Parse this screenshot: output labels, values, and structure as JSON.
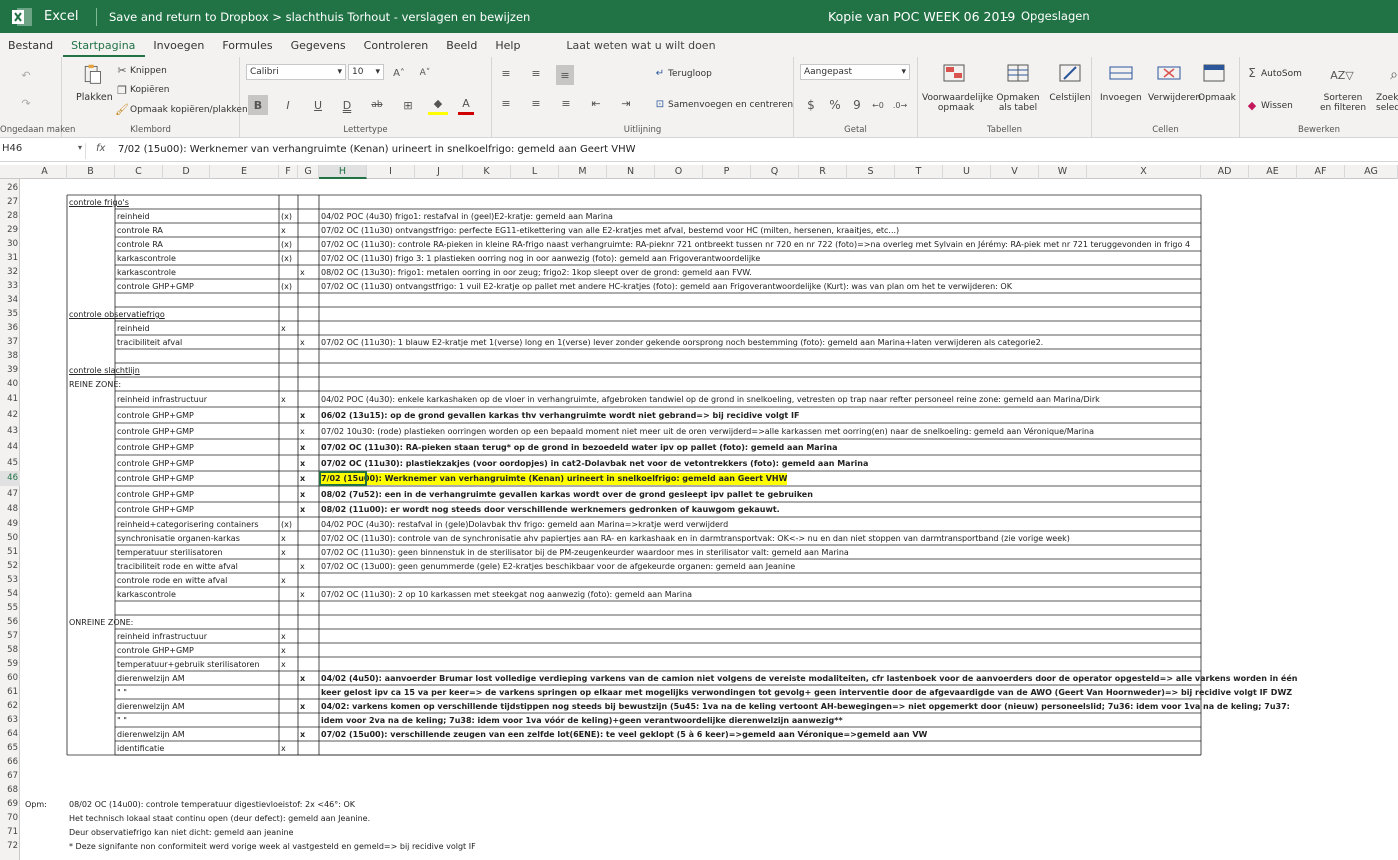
{
  "titlebar": {
    "app": "Excel",
    "breadcrumb": "Save and return to Dropbox  >  slachthuis Torhout - verslagen en bewijzen",
    "doc_title": "Kopie van POC WEEK 06 2019",
    "dash": "-",
    "status": "Opgeslagen"
  },
  "tabs": [
    "Bestand",
    "Startpagina",
    "Invoegen",
    "Formules",
    "Gegevens",
    "Controleren",
    "Beeld",
    "Help"
  ],
  "tell_me": "Laat weten wat u wilt doen",
  "ribbon": {
    "undo_group": "Ongedaan maken",
    "clipboard": {
      "paste": "Plakken",
      "cut": "Knippen",
      "copy": "Kopiëren",
      "format_painter": "Opmaak kopiëren/plakken",
      "label": "Klembord"
    },
    "font": {
      "name": "Calibri",
      "size": "10",
      "bold": "B",
      "italic": "I",
      "underline": "U",
      "double_underline": "D",
      "strike": "ab",
      "label": "Lettertype"
    },
    "alignment": {
      "wrap": "Terugloop",
      "merge": "Samenvoegen en centreren",
      "label": "Uitlijning"
    },
    "number": {
      "format": "Aangepast",
      "currency": "$",
      "percent": "%",
      "comma": "9",
      "label": "Getal"
    },
    "tables": {
      "conditional": "Voorwaardelijke opmaak",
      "format_table": "Opmaken als tabel",
      "cell_styles": "Celstijlen",
      "label": "Tabellen"
    },
    "cells": {
      "insert": "Invoegen",
      "delete": "Verwijderen",
      "format": "Opmaak",
      "label": "Cellen"
    },
    "editing": {
      "autosum": "AutoSom",
      "clear": "Wissen",
      "sort": "Sorteren en filteren",
      "find": "Zoeken en selecteren",
      "label": "Bewerken"
    }
  },
  "formula_bar": {
    "name_box": "H46",
    "fx": "fx",
    "value": "7/02 (15u00): Werknemer van verhangruimte (Kenan) urineert in snelkoelfrigo: gemeld aan Geert VHW"
  },
  "columns": [
    "A",
    "B",
    "C",
    "D",
    "E",
    "F",
    "G",
    "H",
    "I",
    "J",
    "K",
    "L",
    "M",
    "N",
    "O",
    "P",
    "Q",
    "R",
    "S",
    "T",
    "U",
    "V",
    "W",
    "X",
    "AD",
    "AE",
    "AF",
    "AG"
  ],
  "selected_column": "H",
  "selected_row": "46",
  "row_numbers": [
    "26",
    "27",
    "28",
    "29",
    "30",
    "31",
    "32",
    "33",
    "34",
    "35",
    "36",
    "37",
    "38",
    "39",
    "40",
    "41",
    "42",
    "43",
    "44",
    "45",
    "46",
    "47",
    "48",
    "49",
    "50",
    "51",
    "52",
    "53",
    "54",
    "55",
    "56",
    "57",
    "58",
    "59",
    "60",
    "61",
    "62",
    "63",
    "64",
    "65",
    "66",
    "67",
    "68",
    "69",
    "70",
    "71",
    "72"
  ],
  "cells": [
    {
      "row": "27",
      "col": "B",
      "text": "controle frigo's",
      "style": "u"
    },
    {
      "row": "28",
      "col": "C",
      "text": "reinheid"
    },
    {
      "row": "28",
      "col": "F",
      "text": "(x)"
    },
    {
      "row": "28",
      "col": "H",
      "text": "04/02 POC (4u30) frigo1: restafval in (geel)E2-kratje: gemeld aan Marina"
    },
    {
      "row": "29",
      "col": "C",
      "text": "controle RA"
    },
    {
      "row": "29",
      "col": "F",
      "text": "x"
    },
    {
      "row": "29",
      "col": "H",
      "text": "07/02 OC (11u30) ontvangstfrigo: perfecte EG11-etikettering van alle E2-kratjes met afval, bestemd voor HC (milten, hersenen, kraaitjes, etc...)"
    },
    {
      "row": "30",
      "col": "C",
      "text": "controle RA"
    },
    {
      "row": "30",
      "col": "F",
      "text": "(x)"
    },
    {
      "row": "30",
      "col": "H",
      "text": "07/02 OC (11u30): controle RA-pieken in kleine RA-frigo naast verhangruimte: RA-pieknr 721 ontbreekt tussen nr 720 en nr 722 (foto)=>na overleg met Sylvain en Jérémy: RA-piek met nr 721 teruggevonden in frigo 4"
    },
    {
      "row": "31",
      "col": "C",
      "text": "karkascontrole"
    },
    {
      "row": "31",
      "col": "F",
      "text": "(x)"
    },
    {
      "row": "31",
      "col": "H",
      "text": "07/02 OC (11u30) frigo 3: 1 plastieken oorring nog in oor aanwezig (foto): gemeld aan Frigoverantwoordelijke"
    },
    {
      "row": "32",
      "col": "C",
      "text": "karkascontrole"
    },
    {
      "row": "32",
      "col": "G",
      "text": "x"
    },
    {
      "row": "32",
      "col": "H",
      "text": "08/02 OC (13u30): frigo1: metalen oorring in oor zeug; frigo2: 1kop sleept over de grond: gemeld aan FVW."
    },
    {
      "row": "33",
      "col": "C",
      "text": "controle GHP+GMP"
    },
    {
      "row": "33",
      "col": "F",
      "text": "(x)"
    },
    {
      "row": "33",
      "col": "H",
      "text": "07/02 OC (11u30) ontvangstfrigo: 1 vuil E2-kratje op pallet met andere HC-kratjes (foto): gemeld aan Frigoverantwoordelijke (Kurt): was van plan om het te verwijderen: OK"
    },
    {
      "row": "35",
      "col": "B",
      "text": "controle observatiefrigo",
      "style": "u"
    },
    {
      "row": "36",
      "col": "C",
      "text": "reinheid"
    },
    {
      "row": "36",
      "col": "F",
      "text": "x"
    },
    {
      "row": "37",
      "col": "C",
      "text": "tracibiliteit afval"
    },
    {
      "row": "37",
      "col": "G",
      "text": "x"
    },
    {
      "row": "37",
      "col": "H",
      "text": "07/02 OC (11u30): 1 blauw E2-kratje met 1(verse) long en 1(verse) lever zonder gekende oorsprong noch bestemming (foto): gemeld aan Marina+laten verwijderen als categorie2."
    },
    {
      "row": "39",
      "col": "B",
      "text": "controle slachtlijn",
      "style": "u"
    },
    {
      "row": "40",
      "col": "B",
      "text": "  REINE ZONE:"
    },
    {
      "row": "41",
      "col": "C",
      "text": "reinheid infrastructuur"
    },
    {
      "row": "41",
      "col": "F",
      "text": "x"
    },
    {
      "row": "41",
      "col": "H",
      "text": "04/02 POC (4u30): enkele karkashaken op de vloer in verhangruimte, afgebroken tandwiel op de grond in snelkoeling, vetresten op trap naar refter personeel reine zone: gemeld aan Marina/Dirk"
    },
    {
      "row": "42",
      "col": "C",
      "text": "controle GHP+GMP"
    },
    {
      "row": "42",
      "col": "G",
      "text": "x",
      "style": "b"
    },
    {
      "row": "42",
      "col": "H",
      "text": "06/02 (13u15): op de grond gevallen karkas thv verhangruimte wordt niet gebrand=> bij recidive volgt IF",
      "style": "b"
    },
    {
      "row": "43",
      "col": "C",
      "text": "controle GHP+GMP"
    },
    {
      "row": "43",
      "col": "G",
      "text": "x"
    },
    {
      "row": "43",
      "col": "H",
      "text": "07/02 10u30: (rode) plastieken oorringen worden op een bepaald moment niet meer uit de oren verwijderd=>alle karkassen met oorring(en) naar de snelkoeling: gemeld aan Véronique/Marina"
    },
    {
      "row": "44",
      "col": "C",
      "text": "controle GHP+GMP"
    },
    {
      "row": "44",
      "col": "G",
      "text": "x",
      "style": "b"
    },
    {
      "row": "44",
      "col": "H",
      "text": "07/02 OC (11u30): RA-pieken staan terug* op de grond in bezoedeld water ipv op pallet (foto): gemeld aan Marina",
      "style": "b"
    },
    {
      "row": "45",
      "col": "C",
      "text": "controle GHP+GMP"
    },
    {
      "row": "45",
      "col": "G",
      "text": "x",
      "style": "b"
    },
    {
      "row": "45",
      "col": "H",
      "text": "07/02 OC (11u30): plastiekzakjes (voor oordopjes) in cat2-Dolavbak net voor de vetontrekkers (foto): gemeld aan Marina",
      "style": "b"
    },
    {
      "row": "46",
      "col": "C",
      "text": "controle GHP+GMP"
    },
    {
      "row": "46",
      "col": "G",
      "text": "x",
      "style": "b"
    },
    {
      "row": "46",
      "col": "H",
      "text": "7/02 (15u00): Werknemer van verhangruimte (Kenan) urineert in snelkoelfrigo: gemeld aan Geert VHW",
      "style": "b hl"
    },
    {
      "row": "47",
      "col": "C",
      "text": "controle GHP+GMP"
    },
    {
      "row": "47",
      "col": "G",
      "text": "x",
      "style": "b"
    },
    {
      "row": "47",
      "col": "H",
      "text": "08/02 (7u52): een in de verhangruimte gevallen karkas wordt over de grond gesleept ipv pallet te gebruiken",
      "style": "b"
    },
    {
      "row": "48",
      "col": "C",
      "text": "controle GHP+GMP"
    },
    {
      "row": "48",
      "col": "G",
      "text": "x",
      "style": "b"
    },
    {
      "row": "48",
      "col": "H",
      "text": "08/02 (11u00): er wordt nog steeds door verschillende werknemers gedronken of kauwgom gekauwt.",
      "style": "b"
    },
    {
      "row": "49",
      "col": "C",
      "text": "reinheid+categorisering containers"
    },
    {
      "row": "49",
      "col": "F",
      "text": "(x)"
    },
    {
      "row": "49",
      "col": "H",
      "text": "04/02 POC (4u30): restafval in (gele)Dolavbak thv frigo: gemeld aan Marina=>kratje werd verwijderd"
    },
    {
      "row": "50",
      "col": "C",
      "text": "synchronisatie organen-karkas"
    },
    {
      "row": "50",
      "col": "F",
      "text": "x"
    },
    {
      "row": "50",
      "col": "H",
      "text": "07/02 OC (11u30):  controle van de synchronisatie ahv papiertjes aan RA- en karkashaak en in darmtransportvak: OK<-> nu en dan niet stoppen van darmtransportband (zie vorige week)"
    },
    {
      "row": "51",
      "col": "C",
      "text": "temperatuur sterilisatoren"
    },
    {
      "row": "51",
      "col": "F",
      "text": "x"
    },
    {
      "row": "51",
      "col": "H",
      "text": "07/02 OC (11u30): geen binnenstuk in de sterilisator bij de PM-zeugenkeurder waardoor mes in sterilisator valt: gemeld aan Marina"
    },
    {
      "row": "52",
      "col": "C",
      "text": "tracibiliteit rode en witte afval"
    },
    {
      "row": "52",
      "col": "G",
      "text": "x"
    },
    {
      "row": "52",
      "col": "H",
      "text": "07/02 OC (13u00): geen genummerde (gele) E2-kratjes beschikbaar voor de afgekeurde organen: gemeld aan Jeanine"
    },
    {
      "row": "53",
      "col": "C",
      "text": "controle rode en witte afval"
    },
    {
      "row": "53",
      "col": "F",
      "text": "x"
    },
    {
      "row": "54",
      "col": "C",
      "text": "karkascontrole"
    },
    {
      "row": "54",
      "col": "G",
      "text": "x"
    },
    {
      "row": "54",
      "col": "H",
      "text": "07/02 OC (11u30): 2 op 10 karkassen met steekgat nog aanwezig (foto): gemeld aan Marina"
    },
    {
      "row": "56",
      "col": "B",
      "text": "  ONREINE ZONE:"
    },
    {
      "row": "57",
      "col": "C",
      "text": "reinheid infrastructuur"
    },
    {
      "row": "57",
      "col": "F",
      "text": "x"
    },
    {
      "row": "58",
      "col": "C",
      "text": "controle GHP+GMP"
    },
    {
      "row": "58",
      "col": "F",
      "text": "x"
    },
    {
      "row": "59",
      "col": "C",
      "text": "temperatuur+gebruik sterilisatoren"
    },
    {
      "row": "59",
      "col": "F",
      "text": "x"
    },
    {
      "row": "60",
      "col": "C",
      "text": "dierenwelzijn AM"
    },
    {
      "row": "60",
      "col": "G",
      "text": "x",
      "style": "b"
    },
    {
      "row": "60",
      "col": "H",
      "text": "04/02 (4u50): aanvoerder Brumar lost volledige verdieping varkens van de camion niet volgens de vereiste modaliteiten, cfr lastenboek voor de aanvoerders door de operator opgesteld=> alle varkens worden in één",
      "style": "b"
    },
    {
      "row": "61",
      "col": "C",
      "text": "     \"          \""
    },
    {
      "row": "61",
      "col": "H",
      "text": "keer gelost ipv ca 15 va per keer=> de varkens springen op elkaar met mogelijks verwondingen tot gevolg+ geen interventie door de afgevaardigde van de AWO (Geert Van Hoornweder)=> bij recidive volgt IF DWZ",
      "style": "b"
    },
    {
      "row": "62",
      "col": "C",
      "text": "dierenwelzijn AM"
    },
    {
      "row": "62",
      "col": "G",
      "text": "x",
      "style": "b"
    },
    {
      "row": "62",
      "col": "H",
      "text": "04/02: varkens komen op verschillende tijdstippen nog steeds bij bewustzijn (5u45: 1va na de keling vertoont AH-bewegingen=> niet opgemerkt door (nieuw) personeelslid; 7u36: idem voor 1va na de keling; 7u37:",
      "style": "b"
    },
    {
      "row": "63",
      "col": "C",
      "text": "     \"          \""
    },
    {
      "row": "63",
      "col": "H",
      "text": " idem voor 2va na de keling; 7u38: idem voor 1va vóór de keling)+geen verantwoordelijke dierenwelzijn aanwezig**",
      "style": "b"
    },
    {
      "row": "64",
      "col": "C",
      "text": "dierenwelzijn AM"
    },
    {
      "row": "64",
      "col": "G",
      "text": "x",
      "style": "b"
    },
    {
      "row": "64",
      "col": "H",
      "text": "07/02 (15u00): verschillende zeugen van een zelfde lot(6ENE): te veel geklopt (5 à 6 keer)=>gemeld aan Véronique=>gemeld aan VW",
      "style": "b"
    },
    {
      "row": "65",
      "col": "C",
      "text": "identificatie"
    },
    {
      "row": "65",
      "col": "F",
      "text": "x"
    },
    {
      "row": "69",
      "col": "A",
      "text": "Opm:"
    },
    {
      "row": "69",
      "col": "B",
      "text": "08/02 OC (14u00): controle temperatuur digestievloeistof: 2x <46°: OK"
    },
    {
      "row": "70",
      "col": "B",
      "text": "Het technisch lokaal staat continu open (deur defect): gemeld aan Jeanine."
    },
    {
      "row": "71",
      "col": "B",
      "text": "Deur observatiefrigo kan niet dicht: gemeld aan jeanine"
    },
    {
      "row": "72",
      "col": "B",
      "text": "* Deze signifante non conformiteit werd vorige week al vastgesteld en gemeld=> bij recidive volgt IF"
    }
  ],
  "colors": {
    "excel_green": "#217346",
    "highlight": "#ffff00",
    "ribbon_bg": "#f3f2f1"
  }
}
